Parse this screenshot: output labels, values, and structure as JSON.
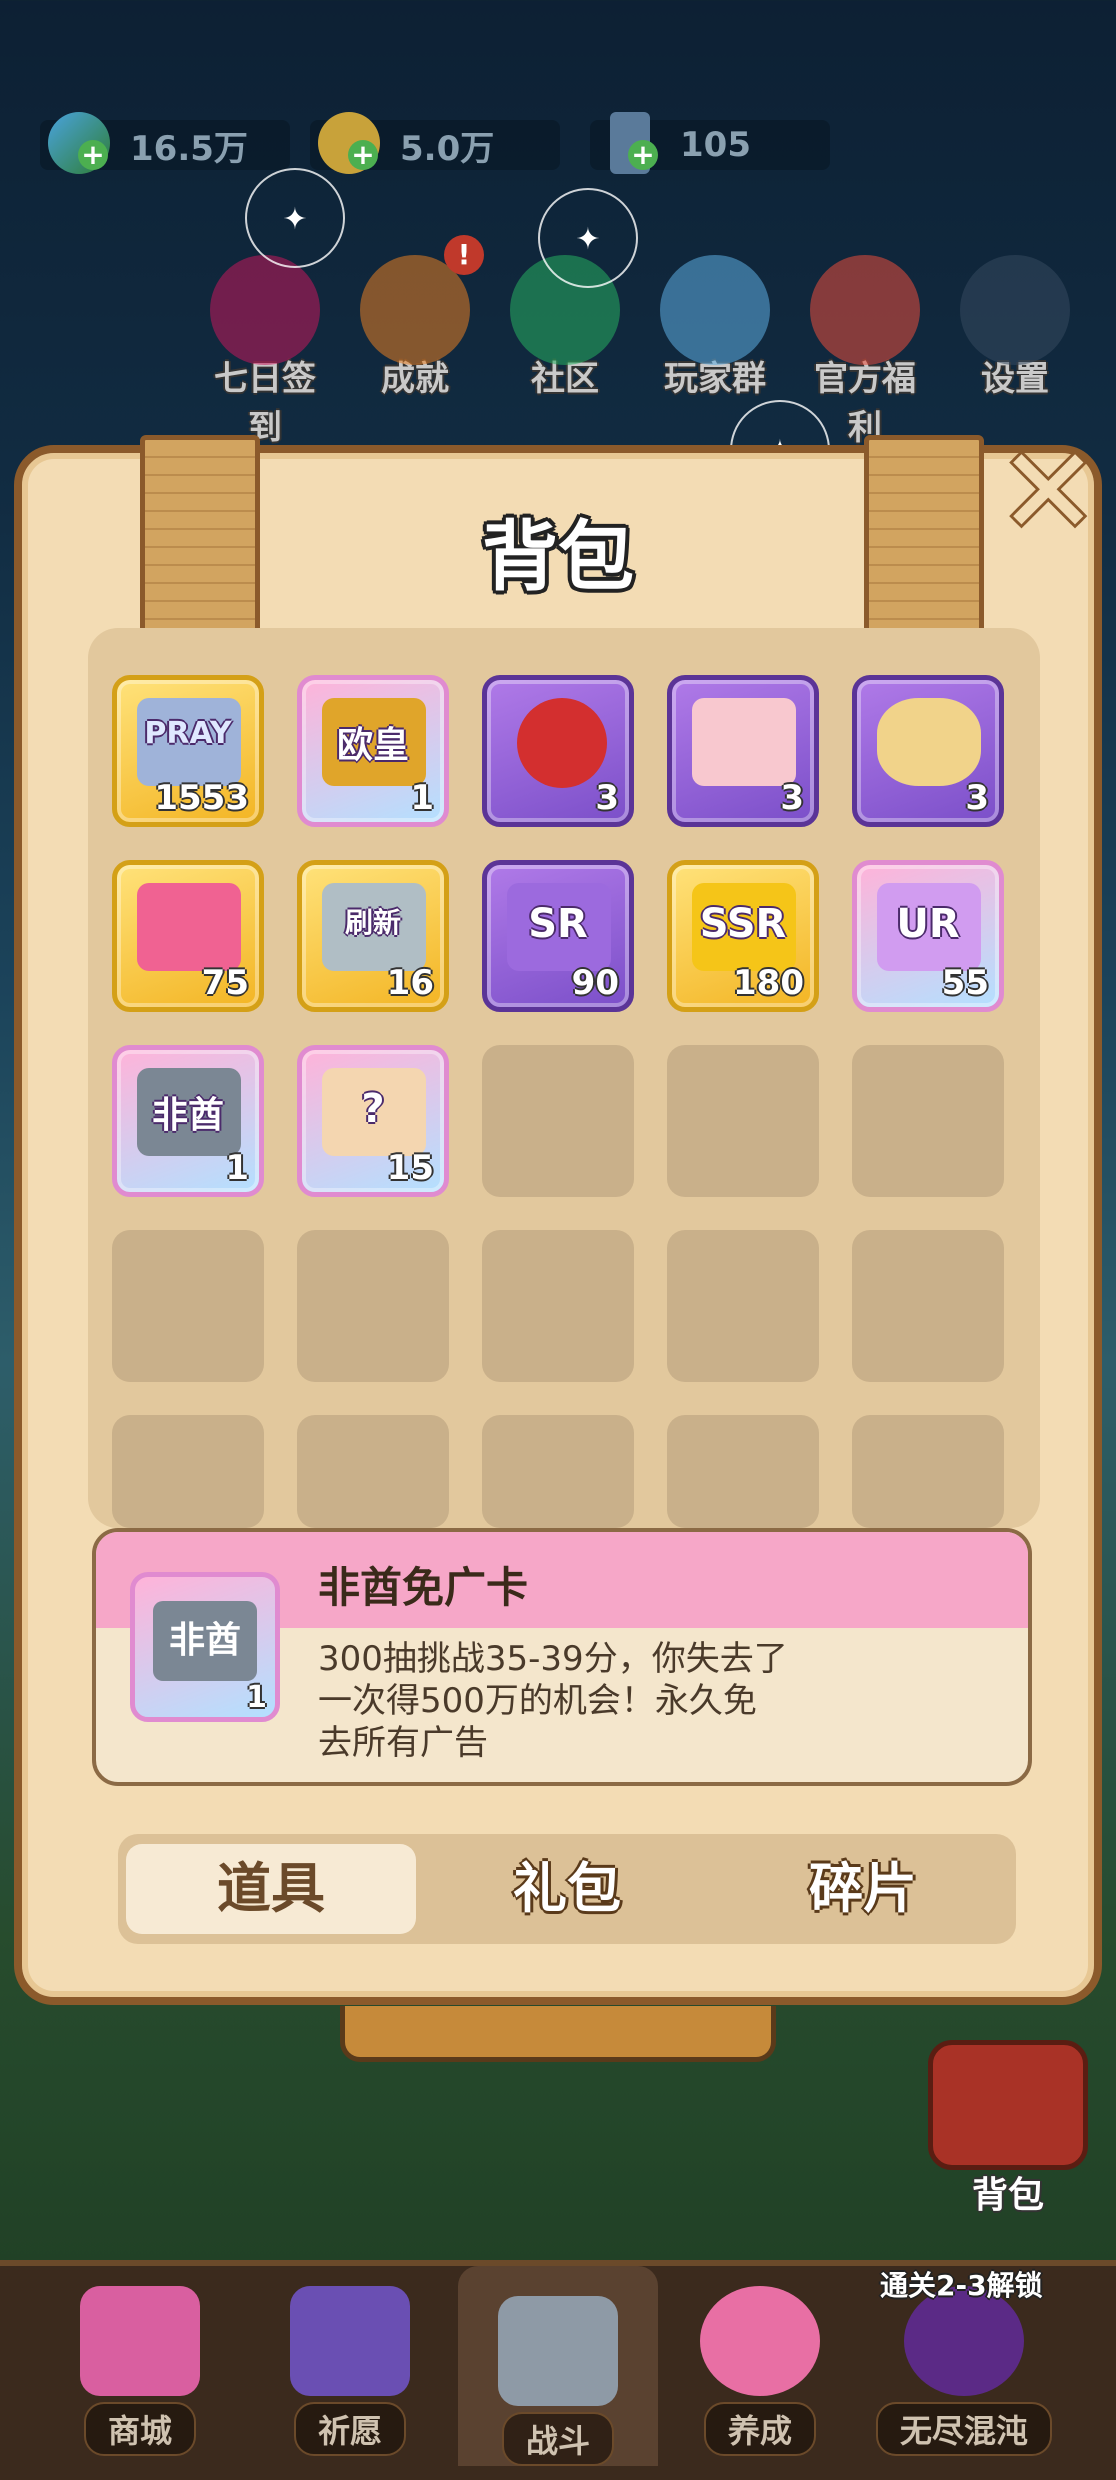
{
  "resources": [
    {
      "icon": "gem-icon",
      "value": "16.5万"
    },
    {
      "icon": "coin-icon",
      "value": "5.0万"
    },
    {
      "icon": "energy-icon",
      "value": "105"
    }
  ],
  "top_menu": [
    {
      "label": "七日签到",
      "icon": "calendar-7-icon"
    },
    {
      "label": "成就",
      "icon": "trophy-icon",
      "badge": "!"
    },
    {
      "label": "社区",
      "icon": "chat-icon"
    },
    {
      "label": "玩家群",
      "icon": "penguin-icon"
    },
    {
      "label": "官方福利",
      "icon": "gift-icon"
    },
    {
      "label": "设置",
      "icon": "gear-icon"
    }
  ],
  "panel": {
    "title": "背包",
    "close": "✕"
  },
  "items": [
    {
      "icon": "pray-ticket-icon",
      "art": "PRAY",
      "count": "1553"
    },
    {
      "icon": "ouhuang-card-icon",
      "art": "欧皇",
      "count": "1"
    },
    {
      "icon": "apple-icon",
      "art": "",
      "count": "3"
    },
    {
      "icon": "cake-icon",
      "art": "",
      "count": "3"
    },
    {
      "icon": "chips-icon",
      "art": "",
      "count": "3"
    },
    {
      "icon": "pink-ticket-icon",
      "art": "",
      "count": "75"
    },
    {
      "icon": "refresh-card-icon",
      "art": "刷新",
      "count": "16"
    },
    {
      "icon": "sr-fragment-icon",
      "art": "SR",
      "count": "90"
    },
    {
      "icon": "ssr-fragment-icon",
      "art": "SSR",
      "count": "180"
    },
    {
      "icon": "ur-fragment-icon",
      "art": "UR",
      "count": "55"
    },
    {
      "icon": "feiyou-card-icon",
      "art": "非酋",
      "count": "1"
    },
    {
      "icon": "mystery-bag-icon",
      "art": "?",
      "count": "15"
    }
  ],
  "detail": {
    "name": "非酋免广卡",
    "art": "非酋",
    "count": "1",
    "description": "300抽挑战35-39分，你失去了一次得500万的机会！永久免去所有广告"
  },
  "tabs": [
    {
      "label": "道具",
      "active": true
    },
    {
      "label": "礼包",
      "active": false
    },
    {
      "label": "碎片",
      "active": false
    }
  ],
  "bag_button": {
    "label": "背包"
  },
  "bottom_nav": {
    "unlock_hint": "通关2-3解锁",
    "items": [
      {
        "label": "商城",
        "icon": "shop-icon"
      },
      {
        "label": "祈愿",
        "icon": "card-icon"
      },
      {
        "label": "战斗",
        "icon": "swords-icon",
        "active": true
      },
      {
        "label": "养成",
        "icon": "paw-icon"
      },
      {
        "label": "无尽混沌",
        "icon": "lock-icon"
      }
    ]
  },
  "colors": {
    "panel": "#f3dcb4",
    "border": "#8b5a2b",
    "detail_header": "#f6a7c8"
  }
}
